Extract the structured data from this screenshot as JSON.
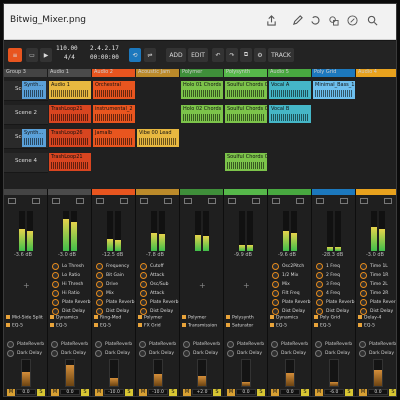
{
  "window": {
    "filename": "Bitwig_Mixer.png"
  },
  "toolbar": {
    "tempo": "110.00",
    "signature": "4/4",
    "position": "2.4.2.17",
    "time": "00:00:00",
    "add_label": "ADD",
    "edit_label": "EDIT",
    "track_label": "TRACK"
  },
  "tracks": [
    {
      "name": "Group 3",
      "color": "#444444"
    },
    {
      "name": "Audio 1",
      "color": "#4b4b4b"
    },
    {
      "name": "Audio 2",
      "color": "#e8551f"
    },
    {
      "name": "Acoustic Jam",
      "color": "#bb8a2a"
    },
    {
      "name": "Polymer",
      "color": "#3f8f3a"
    },
    {
      "name": "Polysynth",
      "color": "#56b84a"
    },
    {
      "name": "Audio 5",
      "color": "#48a840"
    },
    {
      "name": "Poly Grid",
      "color": "#1c78bd"
    },
    {
      "name": "Audio 4",
      "color": "#e8a21e"
    }
  ],
  "scenes": [
    "Scene 1",
    "Scene 2",
    "Scene 3",
    "Scene 4"
  ],
  "clips": [
    {
      "text": "Synth...",
      "color": "#5aa0d8",
      "scene": 0,
      "track": 0
    },
    {
      "text": "Audio 1",
      "color": "#e8b840",
      "scene": 0,
      "track": 1
    },
    {
      "text": "Orchestral",
      "color": "#e8551f",
      "scene": 0,
      "track": 2
    },
    {
      "text": "Holo 01 Chords",
      "color": "#7cc34a",
      "scene": 0,
      "track": 4
    },
    {
      "text": "Soulful Chords 03 A",
      "color": "#7cc34a",
      "scene": 0,
      "track": 5
    },
    {
      "text": "Vocal A",
      "color": "#45b6c7",
      "scene": 0,
      "track": 6
    },
    {
      "text": "Minimal_Bass_15 A",
      "color": "#6ec0ef",
      "scene": 0,
      "track": 7
    },
    {
      "text": "TrashLoop21",
      "color": "#d84520",
      "scene": 1,
      "track": 1
    },
    {
      "text": "instrumental_2",
      "color": "#e8551f",
      "scene": 1,
      "track": 2
    },
    {
      "text": "Holo 02 Chords",
      "color": "#7cc34a",
      "scene": 1,
      "track": 4
    },
    {
      "text": "Soulful Chords 03 A",
      "color": "#7cc34a",
      "scene": 1,
      "track": 5
    },
    {
      "text": "Vocal B",
      "color": "#45b6c7",
      "scene": 1,
      "track": 6
    },
    {
      "text": "Synth...",
      "color": "#5aa0d8",
      "scene": 2,
      "track": 0
    },
    {
      "text": "TrashLoop26",
      "color": "#d84520",
      "scene": 2,
      "track": 1
    },
    {
      "text": "Jamalb",
      "color": "#e8551f",
      "scene": 2,
      "track": 2
    },
    {
      "text": "Vibe 00 Lead",
      "color": "#e8b840",
      "scene": 2,
      "track": 3
    },
    {
      "text": "Soulful Chords 03 A",
      "color": "#7cc34a",
      "scene": 3,
      "track": 5
    },
    {
      "text": "TrashLoop21",
      "color": "#d84520",
      "scene": 3,
      "track": 1
    }
  ],
  "mixer": {
    "strips": [
      {
        "db": "-3.6 dB",
        "level": 0.55,
        "vol": "0.0"
      },
      {
        "db": "-3.0 dB",
        "level": 0.8,
        "vol": "0.0"
      },
      {
        "db": "-12.5 dB",
        "level": 0.3,
        "vol": "-10.0"
      },
      {
        "db": "-7.8 dB",
        "level": 0.45,
        "vol": "-10.0"
      },
      {
        "db": "",
        "level": 0.4,
        "vol": "+2.0"
      },
      {
        "db": "-9.9 dB",
        "level": 0.15,
        "vol": "0.0"
      },
      {
        "db": "-9.6 dB",
        "level": 0.5,
        "vol": "0.0"
      },
      {
        "db": "-28.3 dB",
        "level": 0.1,
        "vol": "-6.0"
      },
      {
        "db": "-3.0 dB",
        "level": 0.6,
        "vol": "0.0"
      }
    ],
    "params": [
      {
        "strip": 1,
        "labels": [
          "Lo Thresh",
          "Lo Ratio",
          "Hi Thresh",
          "Hi Ratio",
          "Plate Reverb",
          "Dist Delay"
        ]
      },
      {
        "strip": 2,
        "labels": [
          "Frequency",
          "Bit Gain",
          "Drive",
          "Mix",
          "Plate Reverb",
          "Dist Delay"
        ]
      },
      {
        "strip": 3,
        "labels": [
          "Cutoff",
          "Attack",
          "Osc/Sub",
          "Attack",
          "Plate Reverb",
          "Dist Delay"
        ]
      },
      {
        "strip": 6,
        "labels": [
          "Osc2Pitch",
          "1/2 Mix",
          "Mix",
          "Filt Freq",
          "Plate Reverb",
          "Dist Delay"
        ]
      },
      {
        "strip": 7,
        "labels": [
          "1 Freq",
          "2 Freq",
          "3 Freq",
          "4 Freq",
          "Plate Reverb",
          "Dist Delay"
        ]
      },
      {
        "strip": 8,
        "labels": [
          "Time 1L",
          "Time 1R",
          "Time 2L",
          "Time 2R",
          "Plate Reverb",
          "Dist Delay"
        ]
      }
    ],
    "devices": [
      {
        "strip": 0,
        "a": "Mid-Side Split",
        "b": "EQ-5"
      },
      {
        "strip": 1,
        "a": "Dynamics",
        "b": "EQ-5"
      },
      {
        "strip": 2,
        "a": "Ring-Mod",
        "b": "EQ-5"
      },
      {
        "strip": 3,
        "a": "Polymer",
        "b": "FX Grid"
      },
      {
        "strip": 4,
        "a": "Polymer",
        "b": "Transmission"
      },
      {
        "strip": 5,
        "a": "Polysynth",
        "b": "Saturator"
      },
      {
        "strip": 6,
        "a": "Dynamics",
        "b": "EQ-5"
      },
      {
        "strip": 7,
        "a": "Poly Grid",
        "b": "EQ-5"
      },
      {
        "strip": 8,
        "a": "Delay-4",
        "b": "EQ-5"
      }
    ],
    "fx_sends": [
      "PlateReverb",
      "Dark Delay"
    ]
  }
}
